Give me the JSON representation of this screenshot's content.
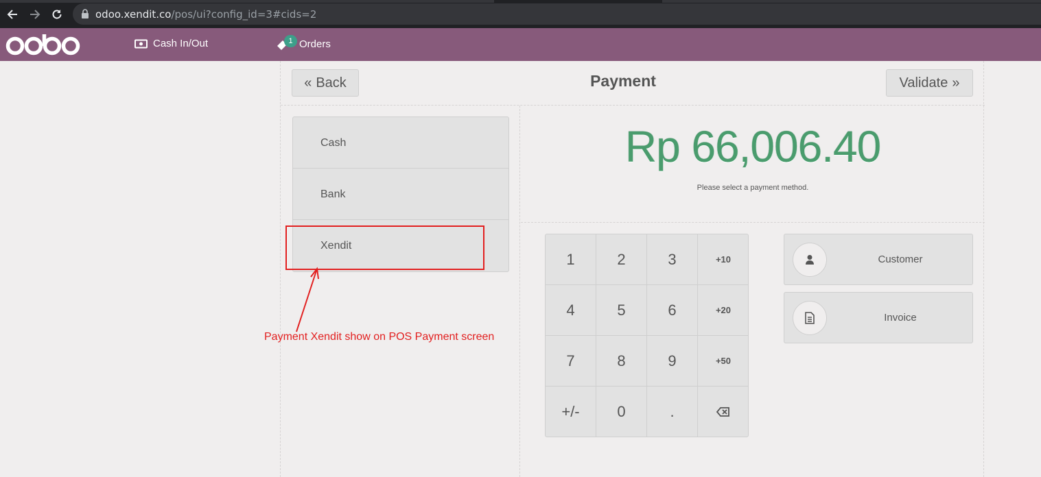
{
  "browser": {
    "url_host": "odoo.xendit.co",
    "url_path": "/pos/ui?config_id=3#cids=2"
  },
  "header": {
    "logo_text": "odoo",
    "cash_label": "Cash In/Out",
    "orders_label": "Orders",
    "orders_badge": "1"
  },
  "payment": {
    "back_label": "Back",
    "title": "Payment",
    "validate_label": "Validate",
    "methods": [
      "Cash",
      "Bank",
      "Xendit"
    ],
    "amount": "Rp 66,006.40",
    "hint": "Please select a payment method.",
    "numpad": [
      "1",
      "2",
      "3",
      "+10",
      "4",
      "5",
      "6",
      "+20",
      "7",
      "8",
      "9",
      "+50",
      "+/-",
      "0",
      ".",
      "backspace"
    ],
    "customer_label": "Customer",
    "invoice_label": "Invoice"
  },
  "annotation": {
    "text": "Payment Xendit show on POS Payment screen",
    "color": "#e21f1f"
  },
  "colors": {
    "header": "#875a7b",
    "amount": "#4a9c6d",
    "badge": "#3d9f8a"
  }
}
